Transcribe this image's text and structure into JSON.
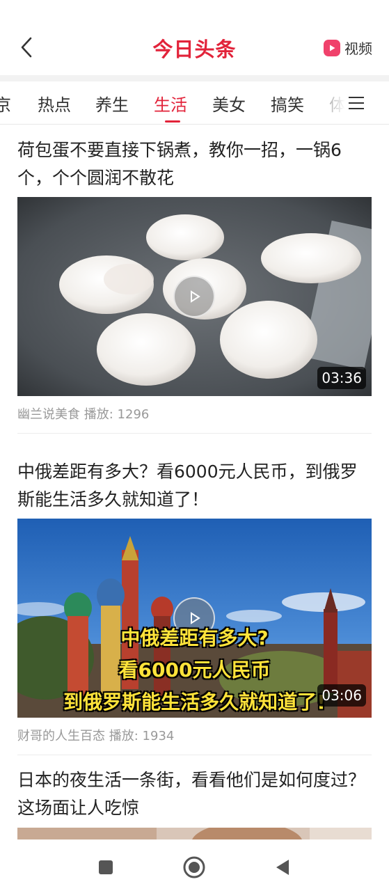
{
  "header": {
    "back_icon": "chevron-left-icon",
    "title": "今日头条",
    "video_link_label": "视频",
    "video_icon": "play-badge-icon",
    "accent_color": "#e2233a"
  },
  "tabs": {
    "items": [
      "京",
      "热点",
      "养生",
      "生活",
      "美女",
      "搞笑",
      "体"
    ],
    "active": "生活",
    "menu_icon": "hamburger-menu-icon"
  },
  "articles": [
    {
      "title": "荷包蛋不要直接下锅煮，教你一招，一锅6个，个个圆润不散花",
      "duration": "03:36",
      "author": "幽兰说美食",
      "plays_label": "播放:",
      "plays": "1296"
    },
    {
      "title": "中俄差距有多大？看6000元人民币，到俄罗斯能生活多久就知道了！",
      "duration": "03:06",
      "caption_lines": [
        "中俄差距有多大?",
        "看6000元人民币",
        "到俄罗斯能生活多久就知道了!"
      ],
      "author": "财哥的人生百态",
      "plays_label": "播放:",
      "plays": "1934"
    },
    {
      "title": "日本的夜生活一条街，看看他们是如何度过？这场面让人吃惊"
    }
  ],
  "navbar": {
    "recent_icon": "square-recent-apps-icon",
    "home_icon": "circle-home-icon",
    "back_icon": "triangle-back-icon"
  }
}
